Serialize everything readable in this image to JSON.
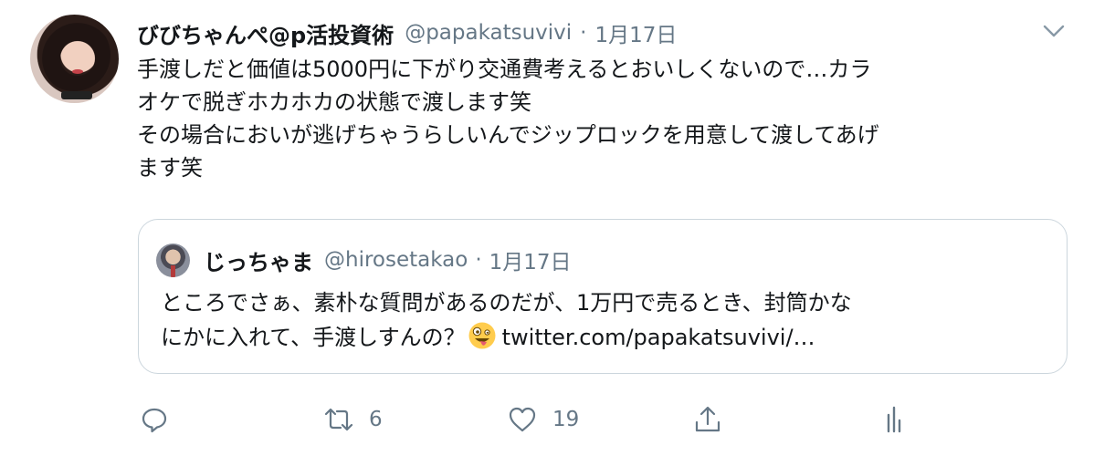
{
  "tweet": {
    "display_name": "びびちゃんぺ@p活投資術",
    "handle": "@papakatsuvivi",
    "separator": "·",
    "time": "1月17日",
    "lines": [
      "手渡しだと価値は5000円に下がり交通費考えるとおいしくないので…カラ",
      "オケで脱ぎホカホカの状態で渡します笑",
      "その場合においが逃げちゃうらしいんでジップロックを用意して渡してあげ",
      "ます笑"
    ]
  },
  "quoted": {
    "display_name": "じっちゃま",
    "handle": "@hirosetakao",
    "separator": "·",
    "time": "1月17日",
    "line1": "ところでさぁ、素朴な質問があるのだが、1万円で売るとき、封筒かな",
    "line2_prefix": "にかに入れて、手渡しすんの？",
    "link": "twitter.com/papakatsuvivi/…",
    "emoji": "zany-face"
  },
  "actions": {
    "reply_count": "",
    "retweet_count": "6",
    "like_count": "19",
    "share_count": ""
  },
  "colors": {
    "text": "#14171a",
    "secondary": "#657786",
    "border": "#ccd6dd"
  }
}
